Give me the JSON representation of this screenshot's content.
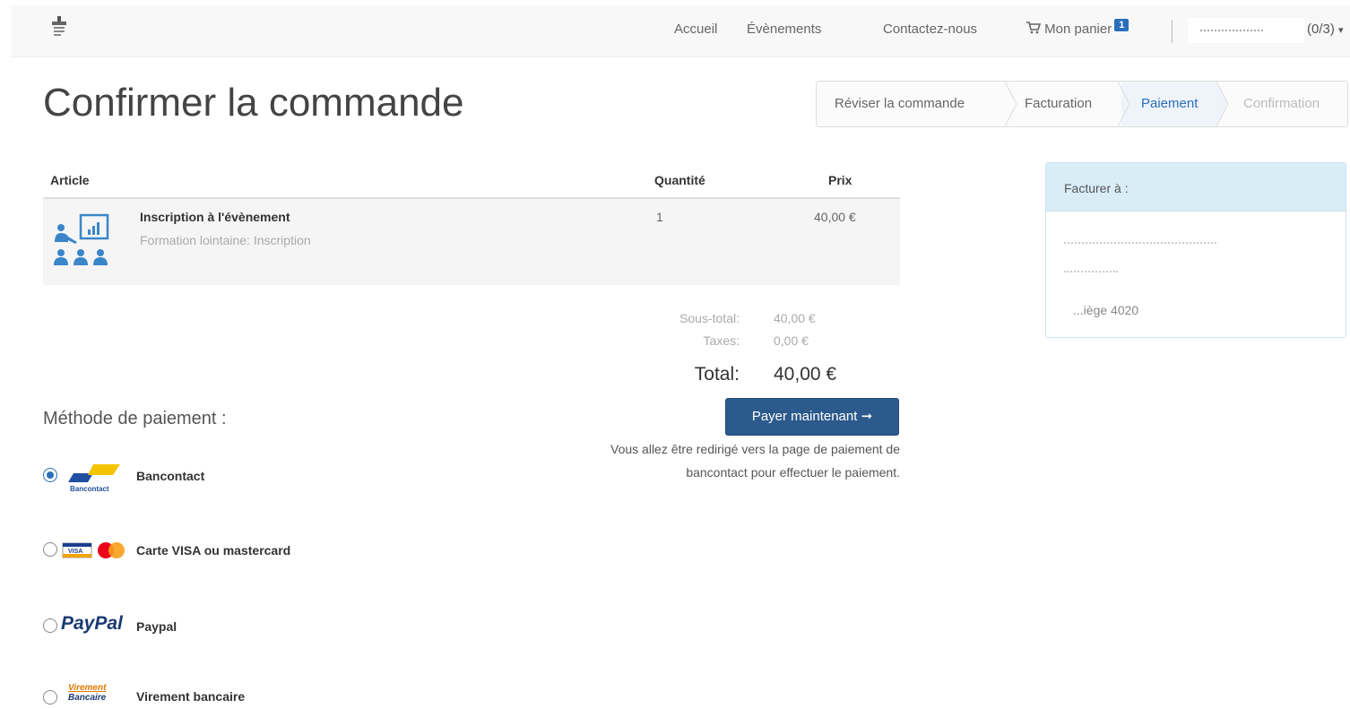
{
  "navbar": {
    "links": [
      "Accueil",
      "Évènements",
      "Contactez-nous"
    ],
    "cart_label": "Mon panier",
    "cart_count": "1",
    "user_suffix": "(0/3)",
    "caret": "▾"
  },
  "page": {
    "title": "Confirmer la commande"
  },
  "steps": [
    {
      "label": "Réviser la commande",
      "state": "done"
    },
    {
      "label": "Facturation",
      "state": "done"
    },
    {
      "label": "Paiement",
      "state": "active"
    },
    {
      "label": "Confirmation",
      "state": "pending"
    }
  ],
  "table": {
    "headers": {
      "article": "Article",
      "quantity": "Quantité",
      "price": "Prix"
    },
    "rows": [
      {
        "name": "Inscription à l'évènement",
        "subtitle": "Formation lointaine: Inscription",
        "quantity": "1",
        "price": "40,00 €",
        "icon": "presentation-audience-icon"
      }
    ]
  },
  "totals": {
    "subtotal_label": "Sous-total:",
    "subtotal": "40,00 €",
    "taxes_label": "Taxes:",
    "taxes": "0,00 €",
    "total_label": "Total:",
    "total": "40,00 €"
  },
  "pay": {
    "button_label": "Payer maintenant",
    "arrow": "➞",
    "redirect_note": "Vous allez être redirigé vers la page de paiement de bancontact pour effectuer le paiement."
  },
  "payment": {
    "title": "Méthode de paiement :",
    "methods": [
      {
        "label": "Bancontact",
        "selected": true,
        "logo_text": "Bancontact"
      },
      {
        "label": "Carte VISA ou mastercard",
        "selected": false,
        "logo_text": "VISA"
      },
      {
        "label": "Paypal",
        "selected": false,
        "logo_text": "PayPal"
      },
      {
        "label": "Virement bancaire",
        "selected": false,
        "logo_text_1": "Virement",
        "logo_text_2": "Bancaire"
      }
    ]
  },
  "bill_to": {
    "title": "Facturer à :",
    "city": "...iège 4020"
  },
  "colors": {
    "accent": "#2a6ebb",
    "pay_button": "#2c5a8c",
    "panel_header": "#d9edf7"
  }
}
